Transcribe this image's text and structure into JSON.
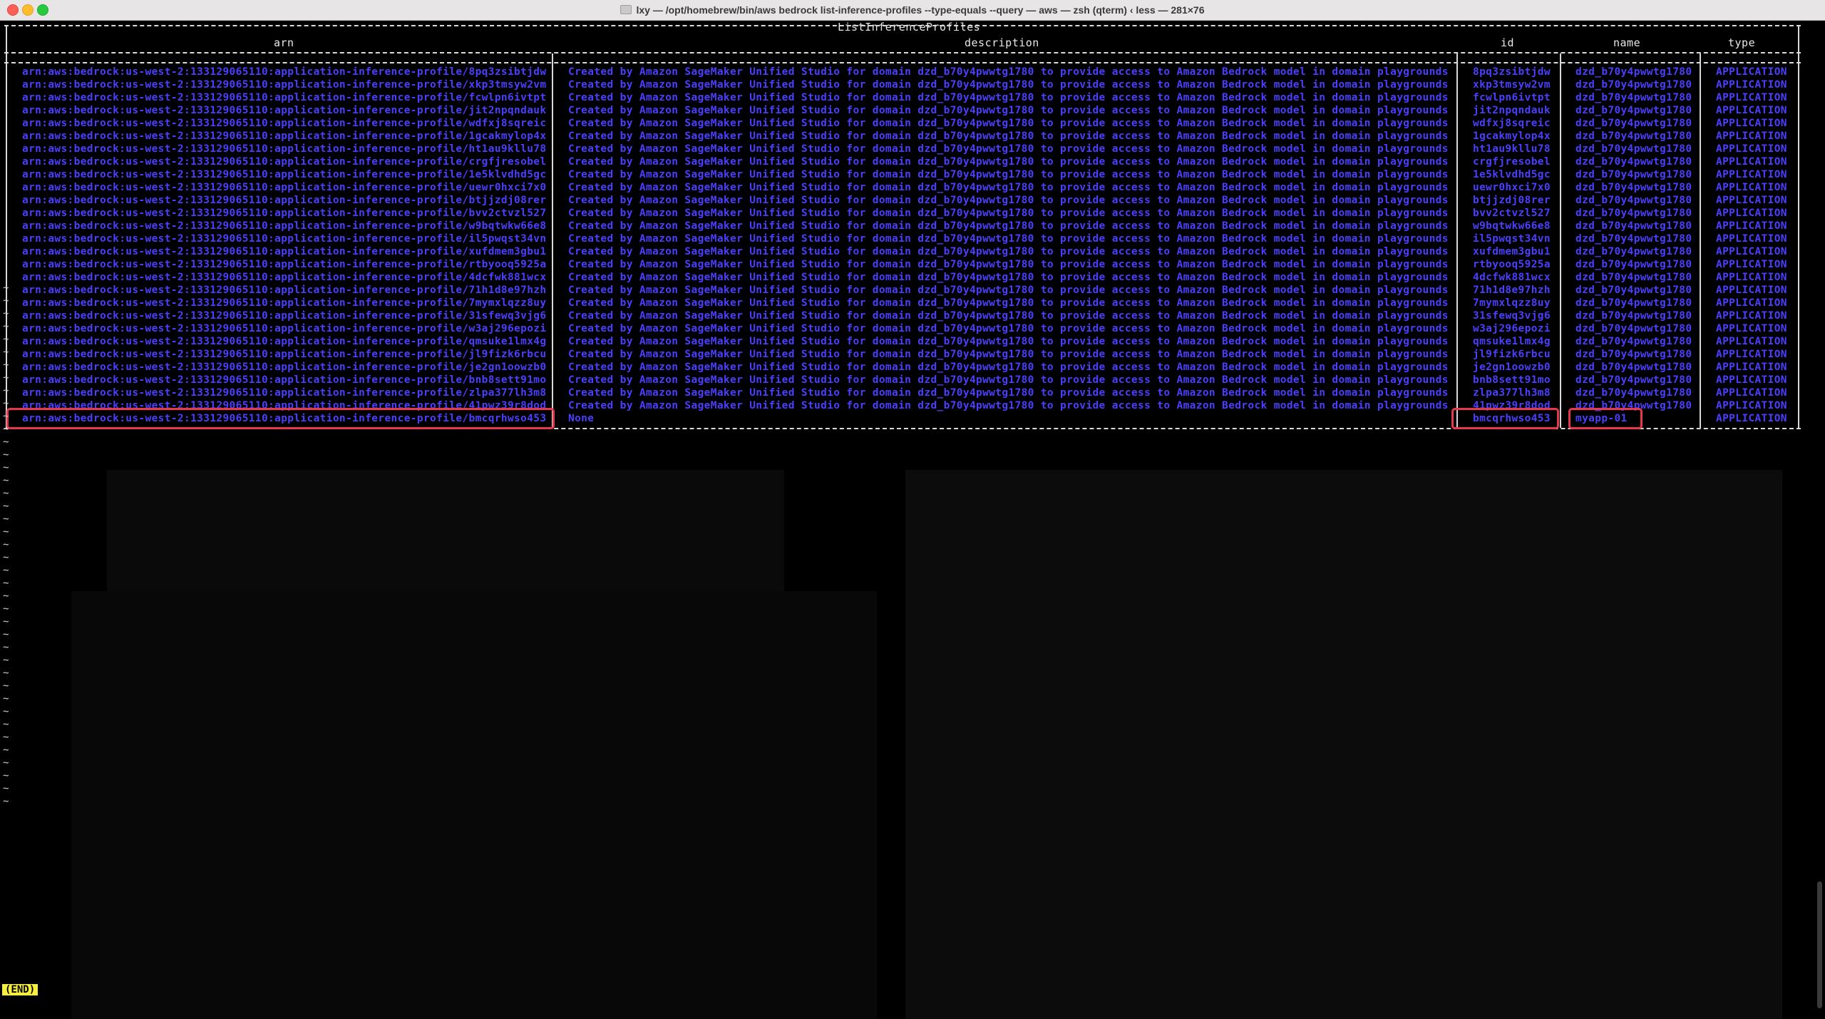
{
  "window": {
    "title": "lxy — /opt/homebrew/bin/aws bedrock list-inference-profiles --type-equals  --query  — aws — zsh (qterm) ‹ less — 281×76"
  },
  "table": {
    "title": "ListInferenceProfiles",
    "headers": {
      "arn": "arn",
      "description": "description",
      "id": "id",
      "name": "name",
      "type": "type"
    },
    "rows": [
      {
        "arn": "arn:aws:bedrock:us-west-2:133129065110:application-inference-profile/8pq3zsibtjdw",
        "description": "Created by Amazon SageMaker Unified Studio for domain dzd_b70y4pwwtg1780 to provide access to Amazon Bedrock model in domain playgrounds",
        "id": "8pq3zsibtjdw",
        "name": "dzd_b70y4pwwtg1780",
        "type": "APPLICATION"
      },
      {
        "arn": "arn:aws:bedrock:us-west-2:133129065110:application-inference-profile/xkp3tmsyw2vm",
        "description": "Created by Amazon SageMaker Unified Studio for domain dzd_b70y4pwwtg1780 to provide access to Amazon Bedrock model in domain playgrounds",
        "id": "xkp3tmsyw2vm",
        "name": "dzd_b70y4pwwtg1780",
        "type": "APPLICATION"
      },
      {
        "arn": "arn:aws:bedrock:us-west-2:133129065110:application-inference-profile/fcwlpn6ivtpt",
        "description": "Created by Amazon SageMaker Unified Studio for domain dzd_b70y4pwwtg1780 to provide access to Amazon Bedrock model in domain playgrounds",
        "id": "fcwlpn6ivtpt",
        "name": "dzd_b70y4pwwtg1780",
        "type": "APPLICATION"
      },
      {
        "arn": "arn:aws:bedrock:us-west-2:133129065110:application-inference-profile/jit2npqndauk",
        "description": "Created by Amazon SageMaker Unified Studio for domain dzd_b70y4pwwtg1780 to provide access to Amazon Bedrock model in domain playgrounds",
        "id": "jit2npqndauk",
        "name": "dzd_b70y4pwwtg1780",
        "type": "APPLICATION"
      },
      {
        "arn": "arn:aws:bedrock:us-west-2:133129065110:application-inference-profile/wdfxj8sqreic",
        "description": "Created by Amazon SageMaker Unified Studio for domain dzd_b70y4pwwtg1780 to provide access to Amazon Bedrock model in domain playgrounds",
        "id": "wdfxj8sqreic",
        "name": "dzd_b70y4pwwtg1780",
        "type": "APPLICATION"
      },
      {
        "arn": "arn:aws:bedrock:us-west-2:133129065110:application-inference-profile/1gcakmylop4x",
        "description": "Created by Amazon SageMaker Unified Studio for domain dzd_b70y4pwwtg1780 to provide access to Amazon Bedrock model in domain playgrounds",
        "id": "1gcakmylop4x",
        "name": "dzd_b70y4pwwtg1780",
        "type": "APPLICATION"
      },
      {
        "arn": "arn:aws:bedrock:us-west-2:133129065110:application-inference-profile/ht1au9kllu78",
        "description": "Created by Amazon SageMaker Unified Studio for domain dzd_b70y4pwwtg1780 to provide access to Amazon Bedrock model in domain playgrounds",
        "id": "ht1au9kllu78",
        "name": "dzd_b70y4pwwtg1780",
        "type": "APPLICATION"
      },
      {
        "arn": "arn:aws:bedrock:us-west-2:133129065110:application-inference-profile/crgfjresobel",
        "description": "Created by Amazon SageMaker Unified Studio for domain dzd_b70y4pwwtg1780 to provide access to Amazon Bedrock model in domain playgrounds",
        "id": "crgfjresobel",
        "name": "dzd_b70y4pwwtg1780",
        "type": "APPLICATION"
      },
      {
        "arn": "arn:aws:bedrock:us-west-2:133129065110:application-inference-profile/1e5klvdhd5gc",
        "description": "Created by Amazon SageMaker Unified Studio for domain dzd_b70y4pwwtg1780 to provide access to Amazon Bedrock model in domain playgrounds",
        "id": "1e5klvdhd5gc",
        "name": "dzd_b70y4pwwtg1780",
        "type": "APPLICATION"
      },
      {
        "arn": "arn:aws:bedrock:us-west-2:133129065110:application-inference-profile/uewr0hxci7x0",
        "description": "Created by Amazon SageMaker Unified Studio for domain dzd_b70y4pwwtg1780 to provide access to Amazon Bedrock model in domain playgrounds",
        "id": "uewr0hxci7x0",
        "name": "dzd_b70y4pwwtg1780",
        "type": "APPLICATION"
      },
      {
        "arn": "arn:aws:bedrock:us-west-2:133129065110:application-inference-profile/btjjzdj08rer",
        "description": "Created by Amazon SageMaker Unified Studio for domain dzd_b70y4pwwtg1780 to provide access to Amazon Bedrock model in domain playgrounds",
        "id": "btjjzdj08rer",
        "name": "dzd_b70y4pwwtg1780",
        "type": "APPLICATION"
      },
      {
        "arn": "arn:aws:bedrock:us-west-2:133129065110:application-inference-profile/bvv2ctvzl527",
        "description": "Created by Amazon SageMaker Unified Studio for domain dzd_b70y4pwwtg1780 to provide access to Amazon Bedrock model in domain playgrounds",
        "id": "bvv2ctvzl527",
        "name": "dzd_b70y4pwwtg1780",
        "type": "APPLICATION"
      },
      {
        "arn": "arn:aws:bedrock:us-west-2:133129065110:application-inference-profile/w9bqtwkw66e8",
        "description": "Created by Amazon SageMaker Unified Studio for domain dzd_b70y4pwwtg1780 to provide access to Amazon Bedrock model in domain playgrounds",
        "id": "w9bqtwkw66e8",
        "name": "dzd_b70y4pwwtg1780",
        "type": "APPLICATION"
      },
      {
        "arn": "arn:aws:bedrock:us-west-2:133129065110:application-inference-profile/il5pwqst34vn",
        "description": "Created by Amazon SageMaker Unified Studio for domain dzd_b70y4pwwtg1780 to provide access to Amazon Bedrock model in domain playgrounds",
        "id": "il5pwqst34vn",
        "name": "dzd_b70y4pwwtg1780",
        "type": "APPLICATION"
      },
      {
        "arn": "arn:aws:bedrock:us-west-2:133129065110:application-inference-profile/xufdmem3gbu1",
        "description": "Created by Amazon SageMaker Unified Studio for domain dzd_b70y4pwwtg1780 to provide access to Amazon Bedrock model in domain playgrounds",
        "id": "xufdmem3gbu1",
        "name": "dzd_b70y4pwwtg1780",
        "type": "APPLICATION"
      },
      {
        "arn": "arn:aws:bedrock:us-west-2:133129065110:application-inference-profile/rtbyooq5925a",
        "description": "Created by Amazon SageMaker Unified Studio for domain dzd_b70y4pwwtg1780 to provide access to Amazon Bedrock model in domain playgrounds",
        "id": "rtbyooq5925a",
        "name": "dzd_b70y4pwwtg1780",
        "type": "APPLICATION"
      },
      {
        "arn": "arn:aws:bedrock:us-west-2:133129065110:application-inference-profile/4dcfwk881wcx",
        "description": "Created by Amazon SageMaker Unified Studio for domain dzd_b70y4pwwtg1780 to provide access to Amazon Bedrock model in domain playgrounds",
        "id": "4dcfwk881wcx",
        "name": "dzd_b70y4pwwtg1780",
        "type": "APPLICATION"
      },
      {
        "arn": "arn:aws:bedrock:us-west-2:133129065110:application-inference-profile/71h1d8e97hzh",
        "description": "Created by Amazon SageMaker Unified Studio for domain dzd_b70y4pwwtg1780 to provide access to Amazon Bedrock model in domain playgrounds",
        "id": "71h1d8e97hzh",
        "name": "dzd_b70y4pwwtg1780",
        "type": "APPLICATION"
      },
      {
        "arn": "arn:aws:bedrock:us-west-2:133129065110:application-inference-profile/7mymxlqzz8uy",
        "description": "Created by Amazon SageMaker Unified Studio for domain dzd_b70y4pwwtg1780 to provide access to Amazon Bedrock model in domain playgrounds",
        "id": "7mymxlqzz8uy",
        "name": "dzd_b70y4pwwtg1780",
        "type": "APPLICATION"
      },
      {
        "arn": "arn:aws:bedrock:us-west-2:133129065110:application-inference-profile/31sfewq3vjg6",
        "description": "Created by Amazon SageMaker Unified Studio for domain dzd_b70y4pwwtg1780 to provide access to Amazon Bedrock model in domain playgrounds",
        "id": "31sfewq3vjg6",
        "name": "dzd_b70y4pwwtg1780",
        "type": "APPLICATION"
      },
      {
        "arn": "arn:aws:bedrock:us-west-2:133129065110:application-inference-profile/w3aj296epozi",
        "description": "Created by Amazon SageMaker Unified Studio for domain dzd_b70y4pwwtg1780 to provide access to Amazon Bedrock model in domain playgrounds",
        "id": "w3aj296epozi",
        "name": "dzd_b70y4pwwtg1780",
        "type": "APPLICATION"
      },
      {
        "arn": "arn:aws:bedrock:us-west-2:133129065110:application-inference-profile/qmsuke1lmx4g",
        "description": "Created by Amazon SageMaker Unified Studio for domain dzd_b70y4pwwtg1780 to provide access to Amazon Bedrock model in domain playgrounds",
        "id": "qmsuke1lmx4g",
        "name": "dzd_b70y4pwwtg1780",
        "type": "APPLICATION"
      },
      {
        "arn": "arn:aws:bedrock:us-west-2:133129065110:application-inference-profile/jl9fizk6rbcu",
        "description": "Created by Amazon SageMaker Unified Studio for domain dzd_b70y4pwwtg1780 to provide access to Amazon Bedrock model in domain playgrounds",
        "id": "jl9fizk6rbcu",
        "name": "dzd_b70y4pwwtg1780",
        "type": "APPLICATION"
      },
      {
        "arn": "arn:aws:bedrock:us-west-2:133129065110:application-inference-profile/je2gn1oowzb0",
        "description": "Created by Amazon SageMaker Unified Studio for domain dzd_b70y4pwwtg1780 to provide access to Amazon Bedrock model in domain playgrounds",
        "id": "je2gn1oowzb0",
        "name": "dzd_b70y4pwwtg1780",
        "type": "APPLICATION"
      },
      {
        "arn": "arn:aws:bedrock:us-west-2:133129065110:application-inference-profile/bnb8sett91mo",
        "description": "Created by Amazon SageMaker Unified Studio for domain dzd_b70y4pwwtg1780 to provide access to Amazon Bedrock model in domain playgrounds",
        "id": "bnb8sett91mo",
        "name": "dzd_b70y4pwwtg1780",
        "type": "APPLICATION"
      },
      {
        "arn": "arn:aws:bedrock:us-west-2:133129065110:application-inference-profile/zlpa377lh3m8",
        "description": "Created by Amazon SageMaker Unified Studio for domain dzd_b70y4pwwtg1780 to provide access to Amazon Bedrock model in domain playgrounds",
        "id": "zlpa377lh3m8",
        "name": "dzd_b70y4pwwtg1780",
        "type": "APPLICATION"
      },
      {
        "arn": "arn:aws:bedrock:us-west-2:133129065110:application-inference-profile/41pwz39r8dod",
        "description": "Created by Amazon SageMaker Unified Studio for domain dzd_b70y4pwwtg1780 to provide access to Amazon Bedrock model in domain playgrounds",
        "id": "41pwz39r8dod",
        "name": "dzd_b70y4pwwtg1780",
        "type": "APPLICATION"
      },
      {
        "arn": "arn:aws:bedrock:us-west-2:133129065110:application-inference-profile/bmcqrhwso453",
        "description": "None",
        "id": "bmcqrhwso453",
        "name": "myapp-01",
        "type": "APPLICATION",
        "highlighted": true
      }
    ]
  },
  "pager": {
    "filler_char": "~",
    "filler_lines": 41,
    "end_prompt": "(END)"
  },
  "colors": {
    "text_blue": "#4b3fff",
    "highlight_red": "#e8394a",
    "prompt_yellow": "#f6f03d"
  }
}
